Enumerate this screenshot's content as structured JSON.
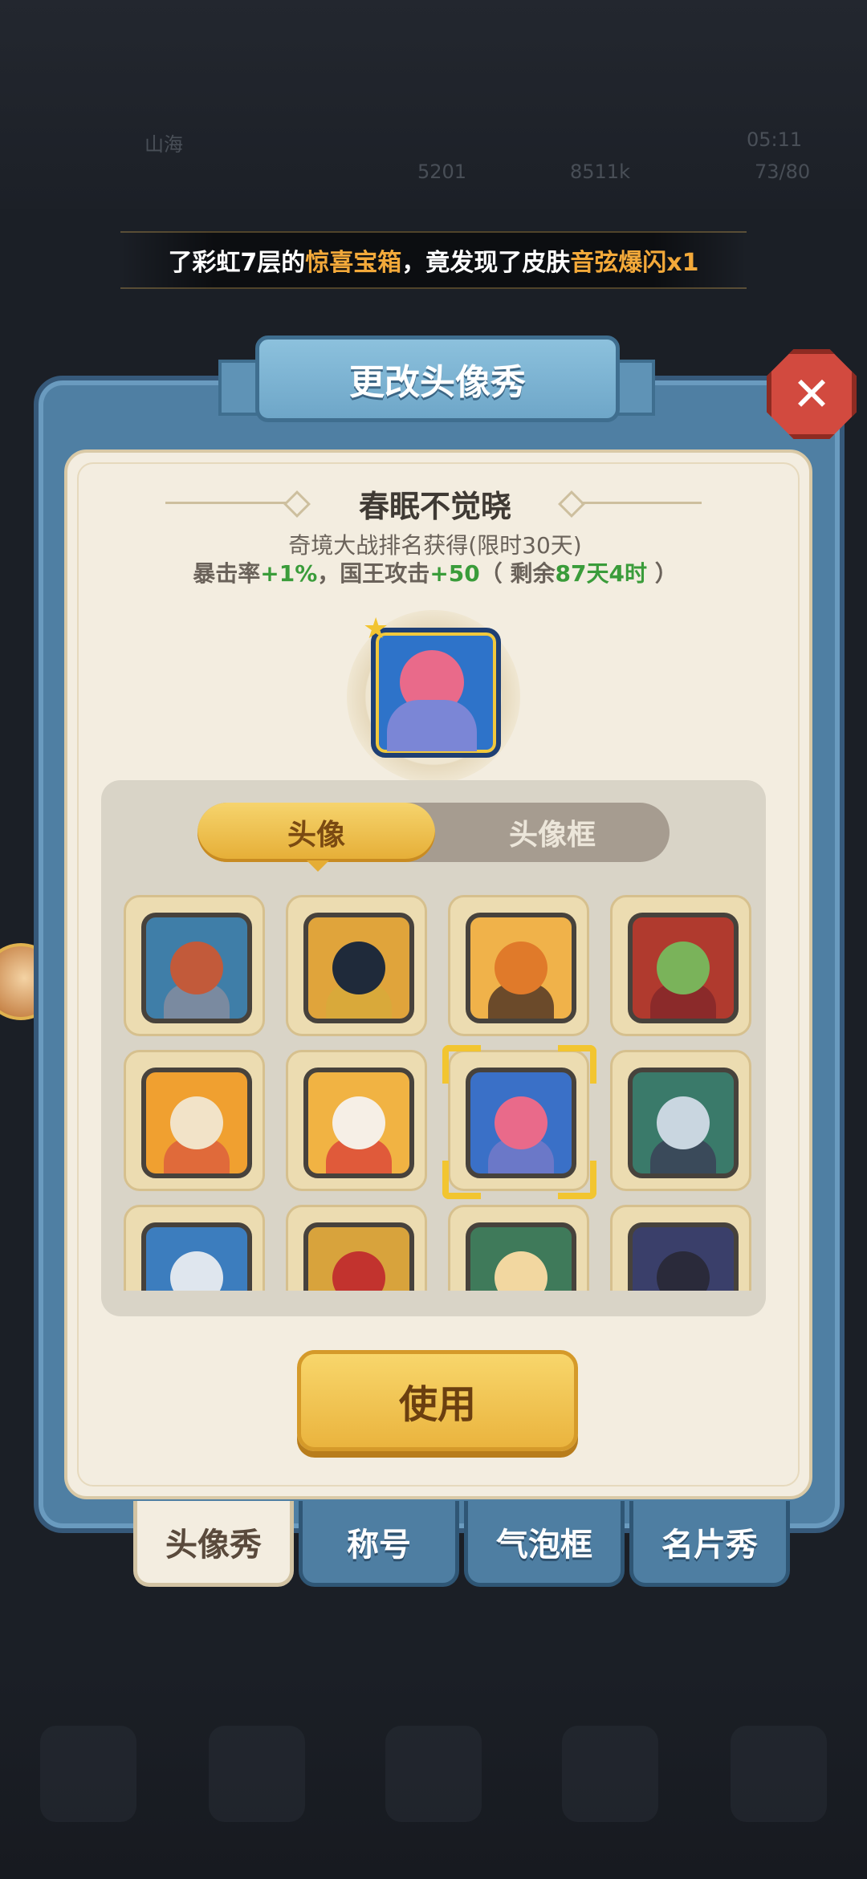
{
  "background": {
    "hud_name": "山海",
    "hud_val_1": "5201",
    "hud_val_2": "8511k",
    "hud_val_3": "73/80",
    "hud_time": "05:11"
  },
  "marquee": {
    "part1": "了彩虹7层的",
    "highlight1": "惊喜宝箱",
    "part2": "，竟发现了皮肤",
    "highlight2": "音弦爆闪x1"
  },
  "dialog": {
    "title": "更改头像秀",
    "close_label": "✕"
  },
  "skin": {
    "name": "春眠不觉晓",
    "source": "奇境大战排名获得(限时30天)",
    "stat_label_1": "暴击率",
    "stat_value_1": "+1%",
    "stat_sep": "，国王攻击",
    "stat_value_2": "+50",
    "remain_prefix": "（ 剩余",
    "remain_value": "87天4时",
    "remain_suffix": " ）"
  },
  "tabs": {
    "avatar": "头像",
    "avatar_frame": "头像框",
    "active": "avatar"
  },
  "avatars": [
    {
      "id": "king",
      "head": "#c25a3a",
      "body": "#7a8aa0",
      "bg": "#3f7ea8"
    },
    {
      "id": "anubis",
      "head": "#1f2a3a",
      "body": "#d9a93a",
      "bg": "#e0a43b"
    },
    {
      "id": "pumpkin",
      "head": "#e07a2a",
      "body": "#6b4a2a",
      "bg": "#f0b24a"
    },
    {
      "id": "witch",
      "head": "#7ab35a",
      "body": "#8b2a2a",
      "bg": "#b03a2e"
    },
    {
      "id": "horse",
      "head": "#f2e3c8",
      "body": "#e06a3a",
      "bg": "#f0a030"
    },
    {
      "id": "lucky",
      "head": "#f6efe6",
      "body": "#e05a3a",
      "bg": "#f1b343"
    },
    {
      "id": "sleeper",
      "head": "#e96a8a",
      "body": "#6b78c8",
      "bg": "#3a70c7",
      "selected": true
    },
    {
      "id": "warrior",
      "head": "#c9d6e0",
      "body": "#3a4a5a",
      "bg": "#3a7a6a"
    },
    {
      "id": "swordsman",
      "head": "#dfe6ee",
      "body": "#3a6ab0",
      "bg": "#3c7dbe"
    },
    {
      "id": "dragon",
      "head": "#c2332e",
      "body": "#7a1f1c",
      "bg": "#d8a33c"
    },
    {
      "id": "elf",
      "head": "#f2d7a0",
      "body": "#3a8a6a",
      "bg": "#3f7a5a"
    },
    {
      "id": "dark",
      "head": "#2a2a3a",
      "body": "#5a4a7a",
      "bg": "#3a3f6a"
    }
  ],
  "use_button": "使用",
  "bottom_tabs": [
    "头像秀",
    "称号",
    "气泡框",
    "名片秀"
  ],
  "colors": {
    "accent_gold": "#e5ad35",
    "highlight_orange": "#f3a93a",
    "stat_green": "#3a9c3a",
    "panel_blue": "#4f7fa3"
  }
}
